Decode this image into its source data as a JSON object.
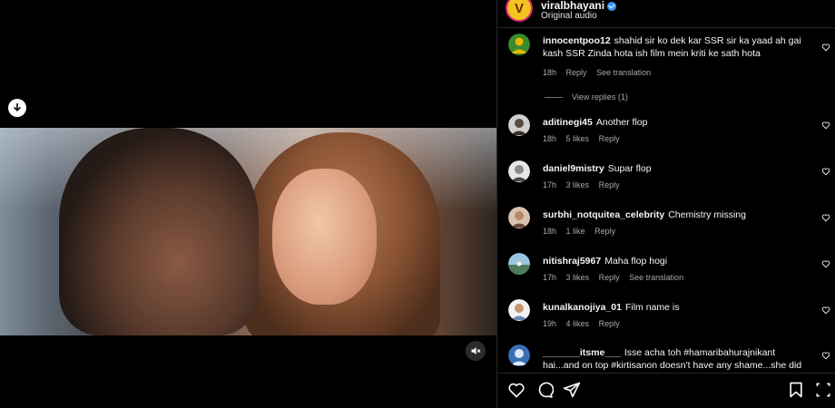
{
  "post": {
    "username": "viralbhayani",
    "avatar_letter": "V",
    "audio": "Original audio"
  },
  "comments": [
    {
      "username": "innocentpoo12",
      "text": "shahid sir ko dek kar SSR sir ka yaad ah gai kash SSR Zinda hota ish film mein kriti ke sath hota",
      "time": "18h",
      "likes": "",
      "reply": "Reply",
      "translate": "See translation",
      "view_replies": "View replies (1)",
      "avatar_color": "#3c8a2e"
    },
    {
      "username": "aditinegi45",
      "text": "Another flop",
      "time": "18h",
      "likes": "5 likes",
      "reply": "Reply",
      "avatar_color": "#5a4a40"
    },
    {
      "username": "daniel9mistry",
      "text": "Supar flop",
      "time": "17h",
      "likes": "3 likes",
      "reply": "Reply",
      "avatar_color": "#9a9a9a"
    },
    {
      "username": "surbhi_notquitea_celebrity",
      "text": "Chemistry missing",
      "time": "18h",
      "likes": "1 like",
      "reply": "Reply",
      "avatar_color": "#b58a6a"
    },
    {
      "username": "nitishraj5967",
      "text": "Maha flop hogi",
      "time": "17h",
      "likes": "3 likes",
      "reply": "Reply",
      "translate": "See translation",
      "avatar_color": "#4f7a5a"
    },
    {
      "username": "kunalkanojiya_01",
      "text": "Film name is",
      "time": "19h",
      "likes": "4 likes",
      "reply": "Reply",
      "avatar_color": "#6a8ab0"
    },
    {
      "username": "_______itsme___",
      "text": "Isse acha toh #hamaribahurajnikant hai...and on top #kirtisanon doesn't have any shame...she did",
      "avatar_color": "#3a6fb5"
    }
  ],
  "icons": {
    "download": "download-icon",
    "mute": "mute-icon",
    "like": "heart-icon",
    "comment": "comment-icon",
    "share": "share-icon",
    "save": "bookmark-icon",
    "more": "more-icon"
  },
  "colors": {
    "background": "#000000",
    "verified": "#3897f0",
    "secondary_text": "#a8a8a8"
  }
}
